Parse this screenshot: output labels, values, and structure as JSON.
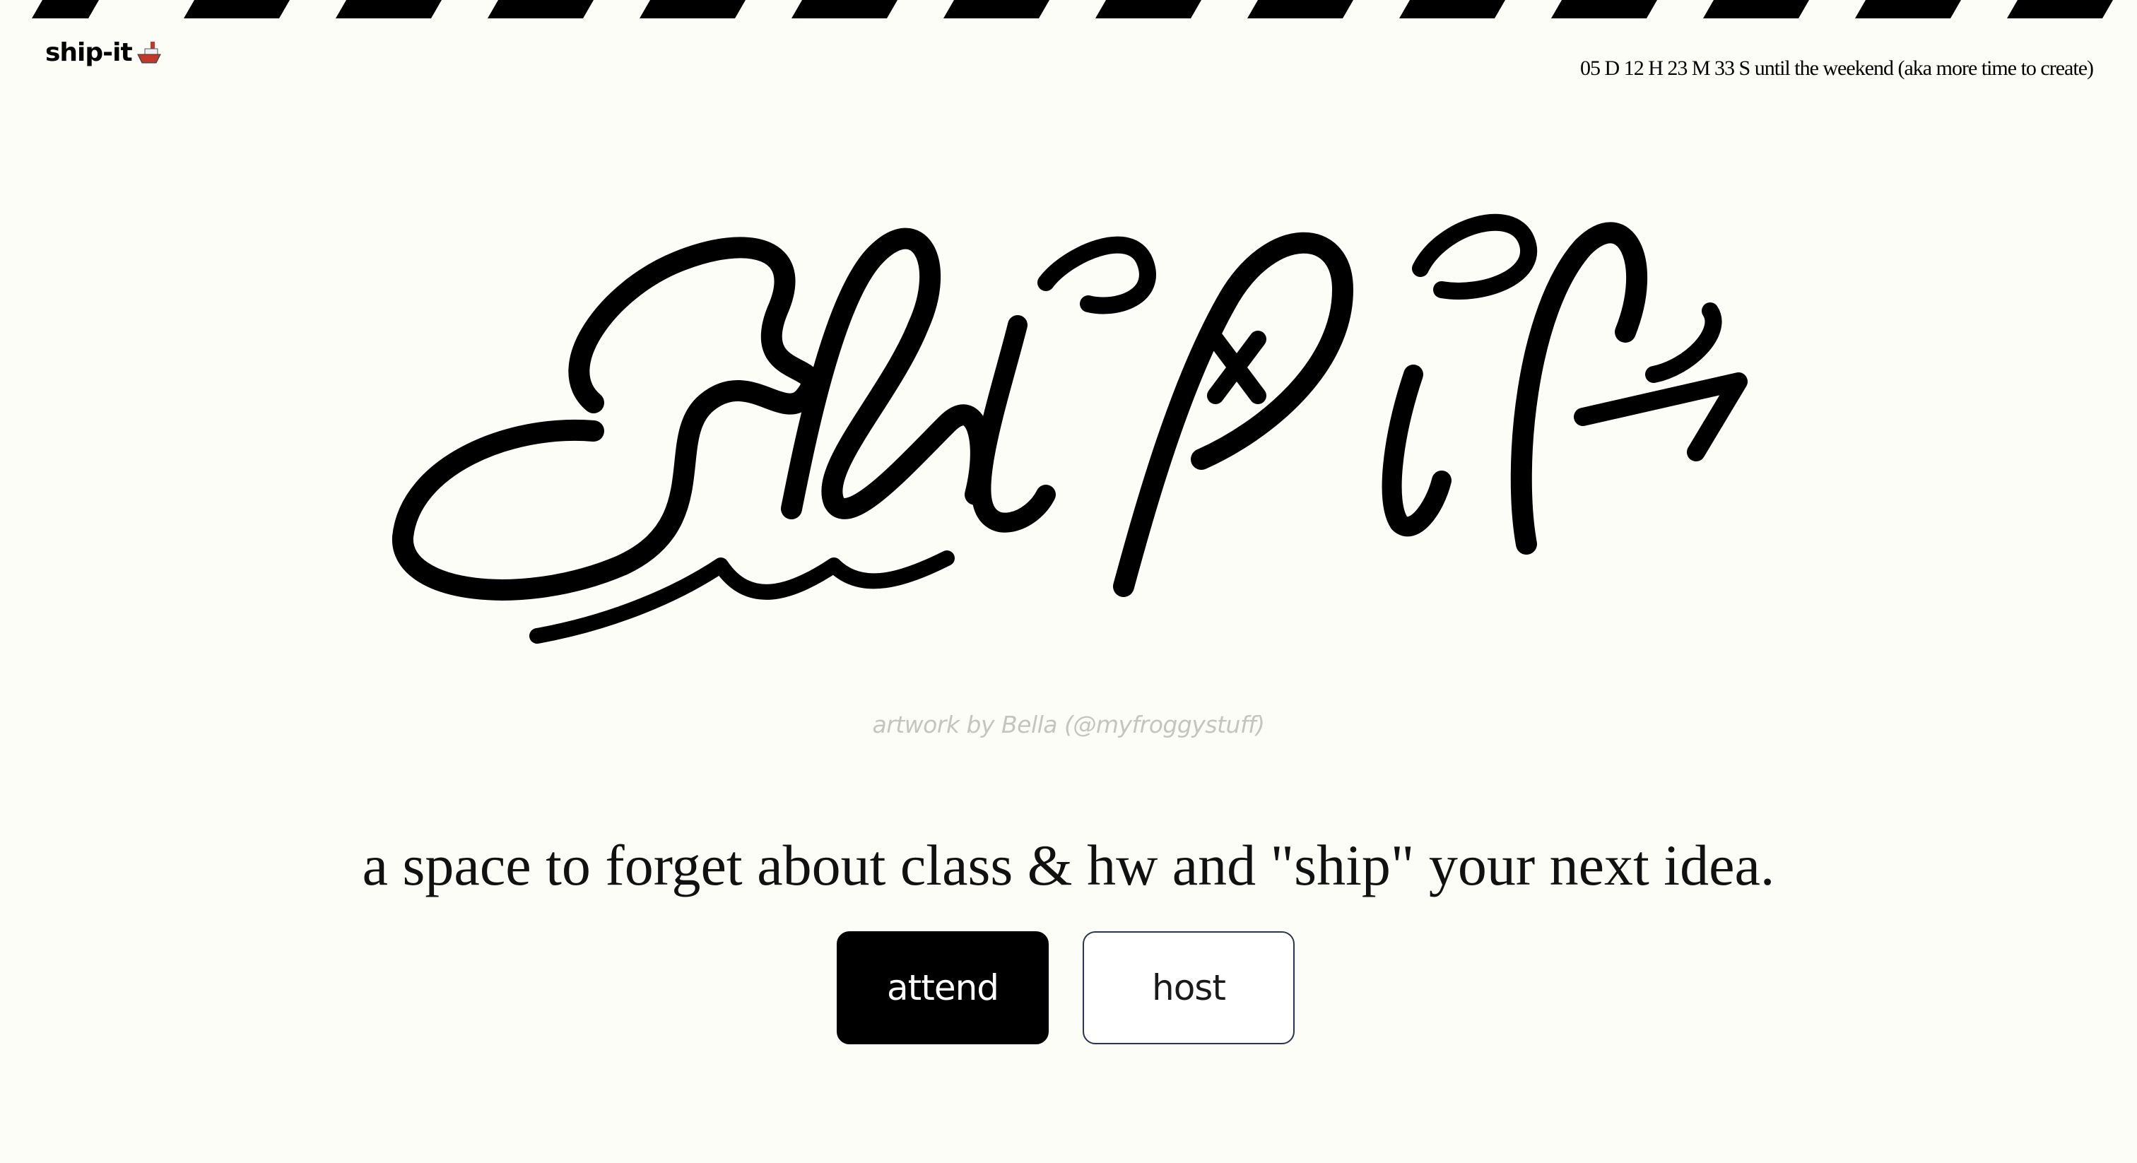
{
  "header": {
    "logo_text": "ship-it",
    "logo_icon": "ship-icon",
    "countdown": "05 D 12 H 23 M 33 S until the weekend (aka more time to create)"
  },
  "hero": {
    "artwork_wordmark": "ship-it",
    "credit": "artwork by Bella (@myfroggystuff)",
    "tagline": "a space to forget about class & hw and \"ship\" your next idea."
  },
  "actions": {
    "attend_label": "attend",
    "host_label": "host"
  },
  "colors": {
    "background": "#fdfdf8",
    "accent": "#000000",
    "ship_red": "#c0392b",
    "credit_gray": "#c4c4c0"
  }
}
